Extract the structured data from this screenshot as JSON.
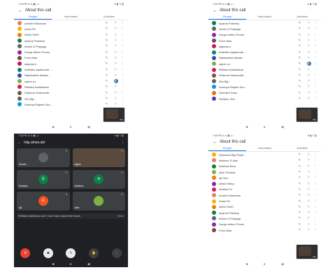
{
  "tl": {
    "status_time": "7:44 PM ⊙ ⊙ ▣ ◇ •",
    "status_icons": "✉ ▮ ◹ ▥",
    "title": "About this call",
    "tabs": [
      "People",
      "Information",
      "Activities"
    ],
    "participants": [
      {
        "name": "Ammini Mohanan",
        "color": "#e67c73"
      },
      {
        "name": "Anish Rv",
        "color": "#f4b400"
      },
      {
        "name": "ANJU RAVI",
        "color": "#f57c00"
      },
      {
        "name": "Aparna Pradeep",
        "color": "#0b8043"
      },
      {
        "name": "Ashmi & Prayaga",
        "color": "#5f6368"
      },
      {
        "name": "Durga vishnu Ponnu",
        "color": "#8e24aa"
      },
      {
        "name": "Fono Maa",
        "color": "#6d4c41"
      },
      {
        "name": "kalpana s",
        "color": "#c2185b"
      },
      {
        "name": "Karthika Jayakumar ...",
        "color": "#00897b"
      },
      {
        "name": "Nakshathra Nanda...",
        "color": "#3949ab"
      },
      {
        "name": "rajeev a.r",
        "color": "#7cb342"
      },
      {
        "name": "Rethika Kaladharan",
        "color": "#d81b60"
      },
      {
        "name": "Shamna Shamsudh...",
        "color": "#795548"
      },
      {
        "name": "Sini Biju",
        "color": "#616161"
      },
      {
        "name": "Soumya Rajesh Sou...",
        "color": "#039be5"
      }
    ],
    "hand_row": 10,
    "pip_label": "You"
  },
  "tr": {
    "status_time": "7:44 PM ⊙ ⊙ ▣ ◇ •",
    "status_icons": "✉ ▮ ◹ ▥",
    "title": "About this call",
    "tabs": [
      "People",
      "Information",
      "Activities"
    ],
    "participants": [
      {
        "name": "Aparna Pradeep",
        "color": "#0b8043"
      },
      {
        "name": "Ashmi & Prayaga",
        "color": "#5f6368"
      },
      {
        "name": "Durga vishnu Ponnu",
        "color": "#8e24aa"
      },
      {
        "name": "Fono Maa",
        "color": "#6d4c41"
      },
      {
        "name": "kalpana s",
        "color": "#c2185b"
      },
      {
        "name": "Karthika Jayakumar ...",
        "color": "#00897b"
      },
      {
        "name": "Nakshathra Nanda...",
        "color": "#3949ab"
      },
      {
        "name": "rajeev a.r",
        "color": "#7cb342"
      },
      {
        "name": "Rethika Kaladharan",
        "color": "#d81b60"
      },
      {
        "name": "Shamna Shamsudh...",
        "color": "#795548"
      },
      {
        "name": "Sini Biju",
        "color": "#616161"
      },
      {
        "name": "Soumya Rajesh Sou...",
        "color": "#039be5"
      },
      {
        "name": "Sreedevi Sanu",
        "color": "#ef6c00"
      },
      {
        "name": "Sreejinu Jinu",
        "color": "#5e35b1"
      }
    ],
    "hand_row": 7,
    "pip_label": "You"
  },
  "bl": {
    "status_time": "7:30 PM ⊙ ⊙ ▣ ◇ •",
    "status_icons": "✉ ▮ ◹ ▥",
    "room": "hdg-ahwq-abr",
    "tiles": [
      {
        "name": "Sreedi...",
        "initial": "",
        "color": "#5f6368",
        "cam": false
      },
      {
        "name": "rajeev",
        "initial": "",
        "color": "#5a4a3d",
        "cam": true
      },
      {
        "name": "Sreejinu",
        "initial": "S",
        "color": "#0b8043",
        "cam": false
      },
      {
        "name": "Abhiram",
        "initial": "A",
        "color": "#0b8043",
        "cam": false
      },
      {
        "name": "Ajt",
        "initial": "A",
        "color": "#f4511e",
        "cam": false
      },
      {
        "name": "Abin",
        "initial": "",
        "color": "#7cb342",
        "cam": false
      }
    ],
    "notice_text": "Rethika Kaladharan and 7 more have raised their hands",
    "notice_action": "Show"
  },
  "br": {
    "status_time": "7:44 PM ⊙ ⊙ ▣ ◇ •",
    "status_icons": "✉ ▮ ◹ ▥",
    "title": "About this call",
    "tabs": [
      "People",
      "Information",
      "Activities"
    ],
    "participants": [
      {
        "name": "Abhinand Biju Radh...",
        "color": "#f4b400"
      },
      {
        "name": "Abhinav R Nair",
        "color": "#e67c73"
      },
      {
        "name": "Abhiram Binu",
        "color": "#0b8043"
      },
      {
        "name": "Abin Thomas",
        "color": "#7cb342"
      },
      {
        "name": "Aji Vinu",
        "color": "#f57c00"
      },
      {
        "name": "Alfred Shiby",
        "color": "#8e24aa"
      },
      {
        "name": "Ambika Pv",
        "color": "#d81b60"
      },
      {
        "name": "Ammini Mohanan",
        "color": "#e67c73"
      },
      {
        "name": "Anish Rv",
        "color": "#f4b400"
      },
      {
        "name": "ANJU RAVI",
        "color": "#f57c00"
      },
      {
        "name": "Aparna Pradeep",
        "color": "#0b8043"
      },
      {
        "name": "Ashmi & Prayaga",
        "color": "#5f6368"
      },
      {
        "name": "Durga vishnu Ponnu",
        "color": "#8e24aa"
      },
      {
        "name": "Fono Maa",
        "color": "#6d4c41"
      }
    ],
    "hand_row": -1,
    "pip_label": "You"
  },
  "icons": {
    "mic": "✎",
    "pin": "⚐",
    "more": "⋮",
    "hand": "✋",
    "back": "←"
  },
  "nav": [
    "■",
    "●",
    "◀"
  ]
}
